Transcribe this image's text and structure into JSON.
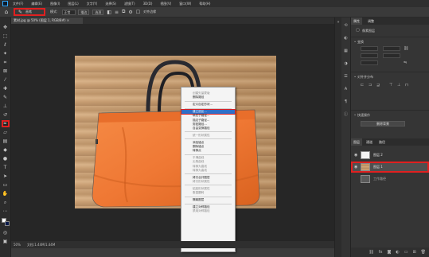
{
  "menubar": {
    "items": [
      "文件(F)",
      "编辑(E)",
      "图像(I)",
      "图层(L)",
      "文字(Y)",
      "选择(S)",
      "滤镜(T)",
      "3D(D)",
      "视图(V)",
      "窗口(W)",
      "帮助(H)"
    ]
  },
  "options": {
    "size_label": "画笔",
    "size_value": "5",
    "mode_label": "模式:",
    "mode_value": "正常",
    "pressure_label": "描边",
    "options_label": "选项",
    "align_label": "对齐边缘"
  },
  "document": {
    "tab_title": "素材.jpg @ 50% (图层 1, RGB/8#) ×",
    "zoom": "50%",
    "doc_info": "文档:1.44M/1.44M"
  },
  "context_menu": {
    "items": [
      {
        "label": "创建矢量蒙版",
        "state": "dim"
      },
      {
        "label": "删除路径",
        "state": "normal"
      },
      {
        "sep": true
      },
      {
        "label": "定义自定形状...",
        "state": "normal"
      },
      {
        "sep": true
      },
      {
        "label": "建立选区...",
        "state": "selected"
      },
      {
        "label": "填充子路径...",
        "state": "normal"
      },
      {
        "label": "描边子路径...",
        "state": "normal"
      },
      {
        "label": "剪贴路径...",
        "state": "normal"
      },
      {
        "label": "自由变换路径",
        "state": "normal"
      },
      {
        "sep": true
      },
      {
        "label": "统一形状属性",
        "state": "dim"
      },
      {
        "sep": true
      },
      {
        "label": "添加锚点",
        "state": "normal"
      },
      {
        "label": "删除锚点",
        "state": "normal"
      },
      {
        "label": "转换点",
        "state": "normal"
      },
      {
        "sep": true
      },
      {
        "label": "平滑曲线",
        "state": "dim"
      },
      {
        "label": "尖角曲线",
        "state": "dim"
      },
      {
        "label": "转换为直线",
        "state": "dim"
      },
      {
        "label": "转换为曲线",
        "state": "dim"
      },
      {
        "sep": true
      },
      {
        "label": "拷贝合并图层",
        "state": "normal"
      },
      {
        "label": "拷贝形状属性",
        "state": "dim"
      },
      {
        "sep": true
      },
      {
        "label": "粘贴形状属性",
        "state": "dim"
      },
      {
        "label": "垂直翻转",
        "state": "dim"
      },
      {
        "sep": true
      },
      {
        "label": "隔离图层",
        "state": "normal"
      },
      {
        "sep": true
      },
      {
        "label": "建立对称路径",
        "state": "normal"
      },
      {
        "label": "禁用对称路径",
        "state": "dim"
      }
    ]
  },
  "panel": {
    "tabs": [
      "属性",
      "调整"
    ],
    "section_transform": "变换",
    "section_align": "对齐并分布",
    "section_quick": "快速操作",
    "quick_button": "删除背景",
    "layer_header_label": "像素图层"
  },
  "layers": {
    "tabs": [
      "图层",
      "通道",
      "路径"
    ],
    "rows": [
      {
        "name": "图层 2",
        "active": false
      },
      {
        "name": "图层 1",
        "active": true
      },
      {
        "name": "工作路径",
        "active": false
      }
    ]
  },
  "colors": {
    "bag_orange": "#f07a38",
    "selection_blue": "#2f6fc7",
    "annotation_red": "#e02020"
  }
}
